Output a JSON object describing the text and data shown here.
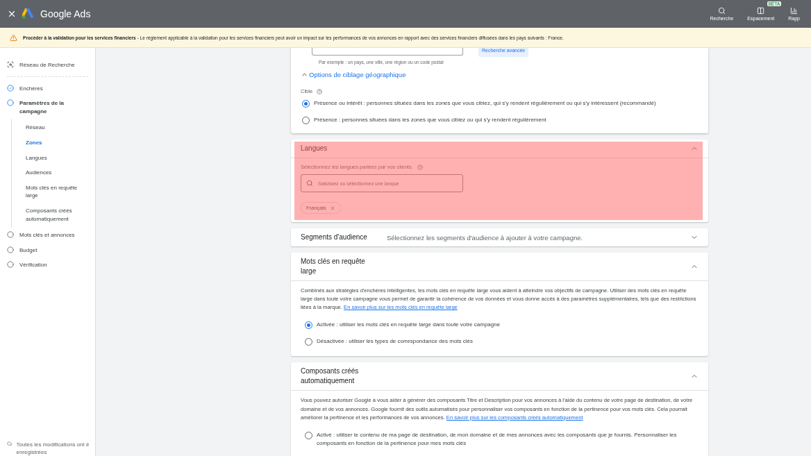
{
  "top_bar": {
    "title": "Google Ads",
    "actions": [
      {
        "kind": "search",
        "label": "Recherche"
      },
      {
        "kind": "spacing",
        "label": "Espacement",
        "badge": "BÊTA"
      },
      {
        "kind": "reports",
        "label": "Rapp"
      }
    ]
  },
  "banner": {
    "text": "**Procéder à la validation pour les services financiers** - Le règlement applicable à la validation pour les services financiers peut avoir un impact sur les performances de vos annonces en rapport avec des services financiers diffusées dans les pays suivants : France."
  },
  "sidebar": {
    "items": [
      {
        "kind": "network",
        "label": "Réseau de Recherche"
      },
      {
        "kind": "done",
        "label": "Enchères"
      },
      {
        "kind": "current",
        "label": "Paramètres de la campagne",
        "children": [
          {
            "label": "Réseau",
            "selected": false
          },
          {
            "label": "Zones",
            "selected": true
          },
          {
            "label": "Langues",
            "selected": false
          },
          {
            "label": "Audiences",
            "selected": false
          },
          {
            "label": "Mots clés en requête large",
            "selected": false
          },
          {
            "label": "Composants créés automatiquement",
            "selected": false
          }
        ]
      },
      {
        "kind": "todo",
        "label": "Mots clés et annonces"
      },
      {
        "kind": "todo",
        "label": "Budget"
      },
      {
        "kind": "todo",
        "label": "Vérification"
      }
    ],
    "footer": "Toutes les modifications ont é enregistrées"
  },
  "location_card": {
    "hint": "Par exemple : un pays, une ville, une région ou un code postal",
    "advanced_button": "Recherche avancée",
    "options_link": "Options de ciblage géographique",
    "expanded": true,
    "target_label": "Cible",
    "options": [
      {
        "label": "Présence ou intérêt : personnes situées dans les zones que vous ciblez, qui s'y rendent régulièrement ou qui s'y intéressent (recommandé)",
        "selected": true
      },
      {
        "label": "Présence : personnes situées dans les zones que vous ciblez ou qui s'y rendent régulièrement",
        "selected": false
      }
    ]
  },
  "sections": [
    {
      "kind": "languages",
      "title": "Langues",
      "expanded": true,
      "highlighted": true,
      "prompt": "Sélectionnez les langues parlées par vos clients.",
      "placeholder": "Saisissez ou sélectionnez une langue",
      "chips": [
        "Français"
      ]
    },
    {
      "kind": "summary",
      "title": "Segments d'audience",
      "summary": "Sélectionnez les segments d'audience à ajouter à votre campagne.",
      "expanded": false
    },
    {
      "kind": "options",
      "title": "Mots clés en requête large",
      "expanded": true,
      "description": "Combinés aux stratégies d'enchères intelligentes, les mots clés en requête large vous aident à atteindre vos objectifs de campagne. Utiliser des mots clés en requête large dans toute votre campagne vous permet de garantir la cohérence de vos données et vous donne accès à des paramètres supplémentaires, tels que des restrictions liées à la marque.",
      "link": "En savoir plus sur les mots clés en requête large",
      "options": [
        {
          "label": "Activée : utiliser les mots clés en requête large dans toute votre campagne",
          "selected": true
        },
        {
          "label": "Désactivée : utiliser les types de correspondance des mots clés",
          "selected": false
        }
      ]
    },
    {
      "kind": "options",
      "title": "Composants créés automatiquement",
      "expanded": true,
      "description": "Vous pouvez autoriser Google à vous aider à générer des composants Titre et Description pour vos annonces à l'aide du contenu de votre page de destination, de votre domaine et de vos annonces. Google fournit des outils automatisés pour personnaliser vos composants en fonction de la pertinence pour vos mots clés. Cela pourrait améliorer la pertinence et les performances de vos annonces.",
      "link": "En savoir plus sur les composants créés automatiquement",
      "options": [
        {
          "label": "Activé : utiliser le contenu de ma page de destination, de mon domaine et de mes annonces avec les composants que je fournis. Personnaliser les composants en fonction de la pertinence pour mes mots clés",
          "selected": false
        }
      ]
    }
  ]
}
